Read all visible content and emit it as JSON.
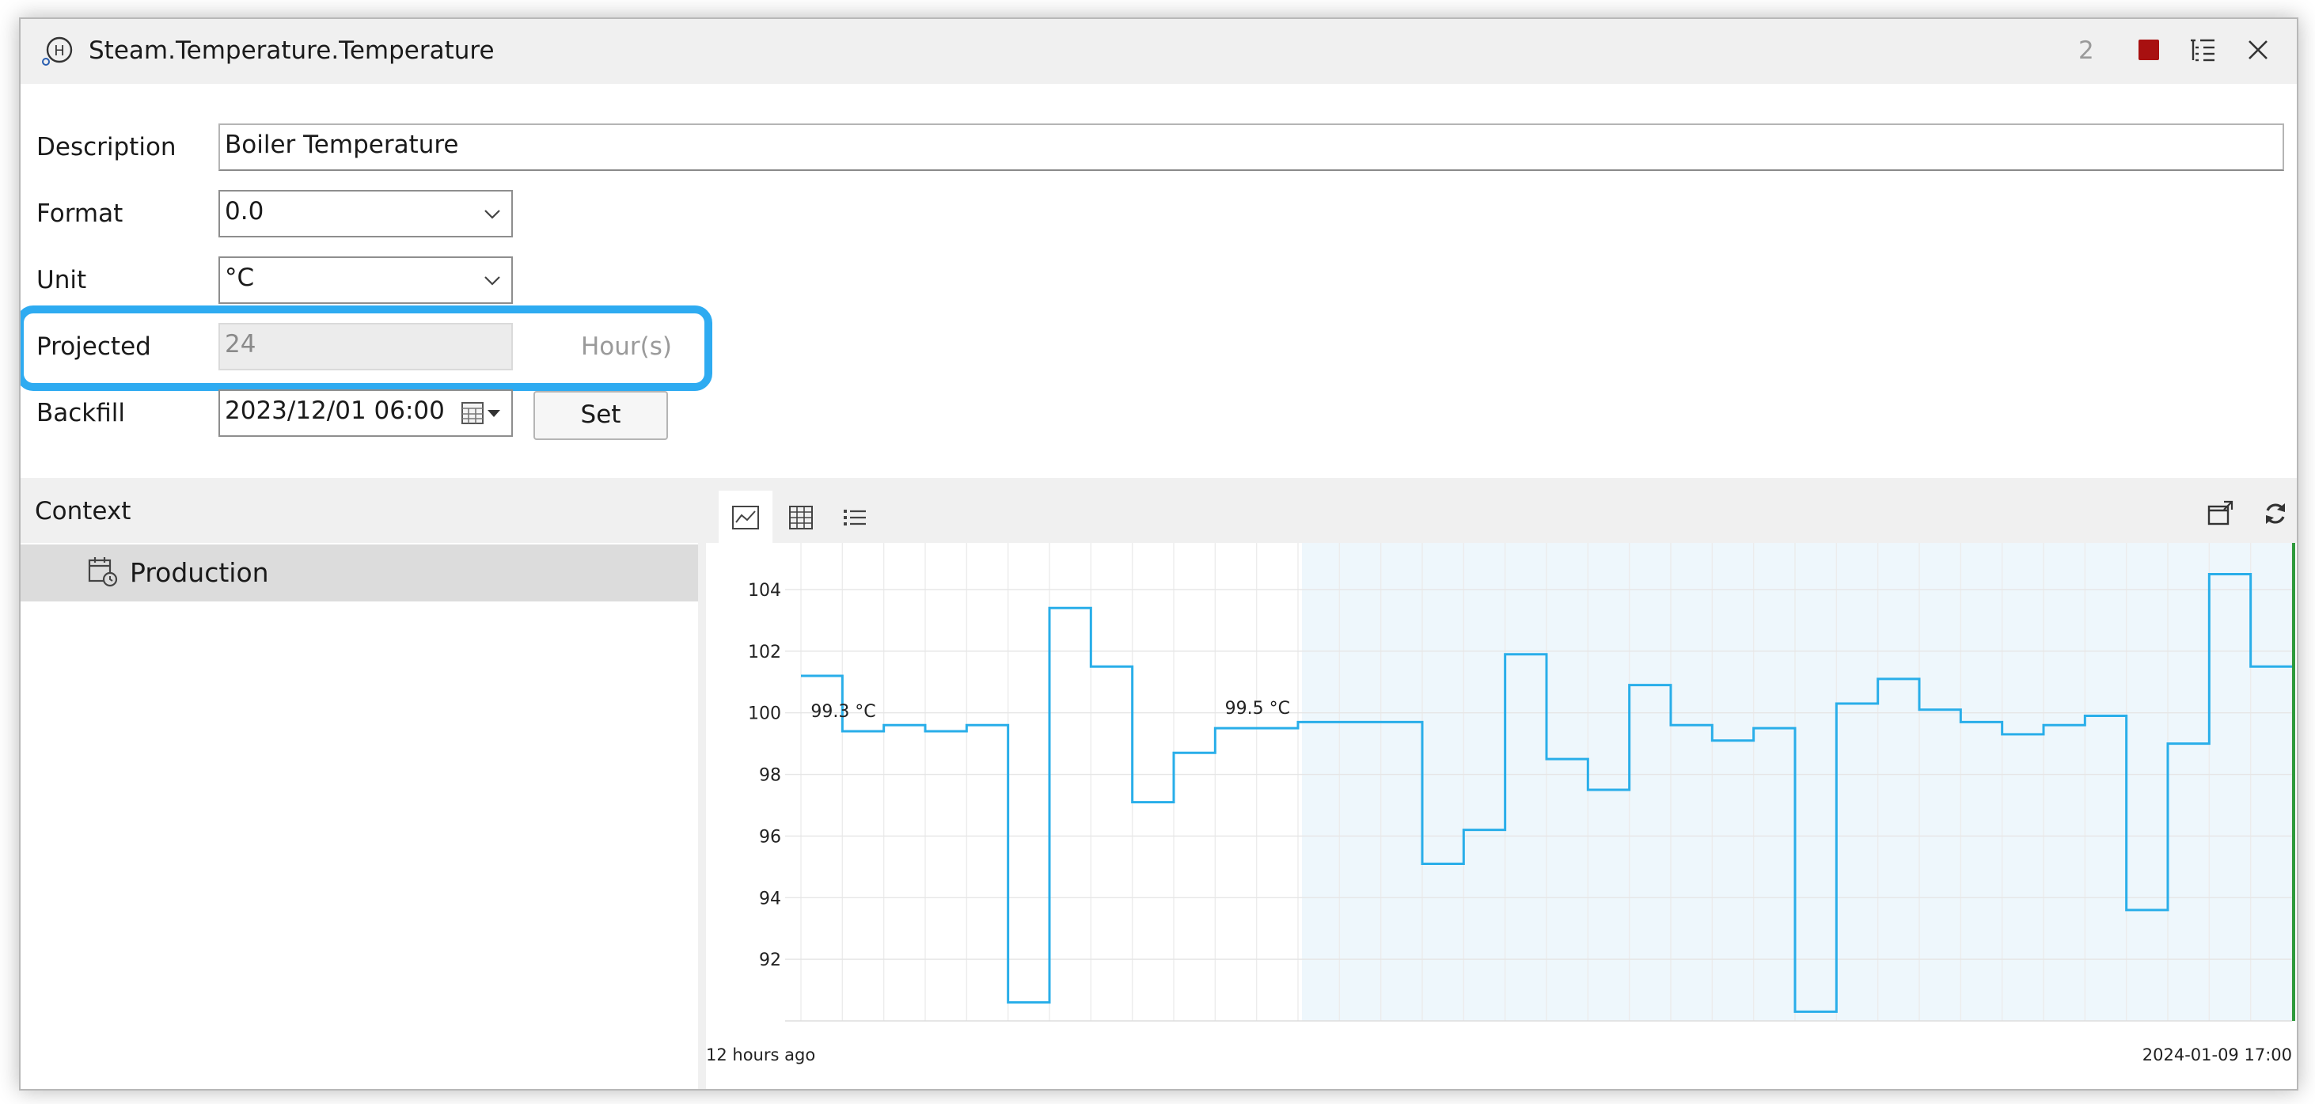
{
  "window": {
    "title": "Steam.Temperature.Temperature",
    "count": "2",
    "icons": {
      "left": "h-circle-icon",
      "stop": "stop-icon",
      "tree": "tree-list-icon",
      "close": "close-icon"
    }
  },
  "form": {
    "description": {
      "label": "Description",
      "value": "Boiler Temperature"
    },
    "format": {
      "label": "Format",
      "value": "0.0"
    },
    "unit": {
      "label": "Unit",
      "value": "°C"
    },
    "projected": {
      "label": "Projected",
      "value": "24",
      "suffix": "Hour(s)"
    },
    "backfill": {
      "label": "Backfill",
      "value": "2023/12/01 06:00",
      "button": "Set"
    }
  },
  "context": {
    "title": "Context",
    "items": [
      {
        "label": "Production",
        "icon": "calendar-clock-icon"
      }
    ]
  },
  "chart_toolbar": {
    "views": [
      "trend-view-icon",
      "table-view-icon",
      "list-view-icon"
    ],
    "active_view": "trend-view-icon",
    "right": [
      "popout-icon",
      "refresh-icon"
    ]
  },
  "colors": {
    "line": "#29aee9",
    "highlight": "#2eabf1",
    "projected_region": "#eef7fc",
    "stop": "#a81010",
    "now_marker": "#2e9a3c"
  },
  "chart_data": {
    "type": "line",
    "step": true,
    "grid": true,
    "ylim": [
      90,
      105
    ],
    "yticks": [
      92,
      94,
      96,
      98,
      100,
      102,
      104
    ],
    "x_start_label": "12 hours ago",
    "x_end_label": "2024-01-09 17:00",
    "projected_region_start_fraction": 0.336,
    "series": [
      {
        "values": [
          101.2,
          99.4,
          99.6,
          99.4,
          99.6,
          90.6,
          103.4,
          101.5,
          97.1,
          98.7,
          99.5,
          99.5,
          99.7,
          99.7,
          99.7,
          95.1,
          96.2,
          101.9,
          98.5,
          97.5,
          100.9,
          99.6,
          99.1,
          99.5,
          90.3,
          100.3,
          101.1,
          100.1,
          99.7,
          99.3,
          99.6,
          99.9,
          93.6,
          99.0,
          104.5,
          101.5
        ]
      }
    ],
    "annotations": [
      {
        "text": "99.3 °C",
        "index": 1
      },
      {
        "text": "99.5 °C",
        "index": 11
      }
    ]
  }
}
